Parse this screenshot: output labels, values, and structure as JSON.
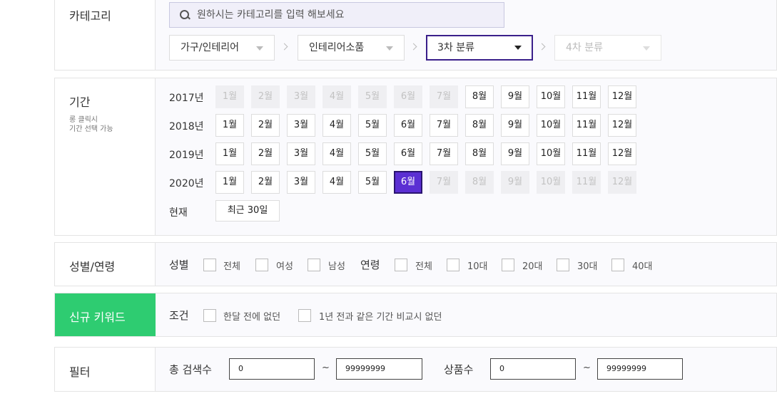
{
  "category": {
    "title": "카테고리",
    "search_placeholder": "원하시는 카테고리를 입력 해보세요",
    "selects": [
      {
        "label": "가구/인테리어",
        "state": "normal"
      },
      {
        "label": "인테리어소품",
        "state": "normal"
      },
      {
        "label": "3차 분류",
        "state": "active"
      },
      {
        "label": "4차 분류",
        "state": "disabled"
      }
    ]
  },
  "period": {
    "title": "기간",
    "hint_line1": "롱 클릭시",
    "hint_line2": "기간 선택 가능",
    "years": [
      {
        "label": "2017년",
        "months": [
          "1월",
          "2월",
          "3월",
          "4월",
          "5월",
          "6월",
          "7월",
          "8월",
          "9월",
          "10월",
          "11월",
          "12월"
        ],
        "disabled_until": 7
      },
      {
        "label": "2018년",
        "months": [
          "1월",
          "2월",
          "3월",
          "4월",
          "5월",
          "6월",
          "7월",
          "8월",
          "9월",
          "10월",
          "11월",
          "12월"
        ]
      },
      {
        "label": "2019년",
        "months": [
          "1월",
          "2월",
          "3월",
          "4월",
          "5월",
          "6월",
          "7월",
          "8월",
          "9월",
          "10월",
          "11월",
          "12월"
        ]
      },
      {
        "label": "2020년",
        "months": [
          "1월",
          "2월",
          "3월",
          "4월",
          "5월",
          "6월",
          "7월",
          "8월",
          "9월",
          "10월",
          "11월",
          "12월"
        ],
        "selected": 6,
        "disabled_from": 7
      }
    ],
    "current_label": "현재",
    "recent_button": "최근 30일"
  },
  "demographics": {
    "title": "성별/연령",
    "gender_label": "성별",
    "gender_options": [
      "전체",
      "여성",
      "남성"
    ],
    "age_label": "연령",
    "age_options": [
      "전체",
      "10대",
      "20대",
      "30대",
      "40대"
    ]
  },
  "new_keyword": {
    "title": "신규 키워드",
    "condition_label": "조건",
    "options": [
      "한달 전에 없던",
      "1년 전과 같은 기간 비교시 없던"
    ]
  },
  "filter": {
    "title": "필터",
    "search_label": "총 검색수",
    "search_min": "0",
    "search_max": "99999999",
    "product_label": "상품수",
    "product_min": "0",
    "product_max": "99999999",
    "tilde": "~"
  },
  "colors": {
    "accent": "#5b2fd3",
    "new_keyword_bg": "#2ecc71"
  }
}
